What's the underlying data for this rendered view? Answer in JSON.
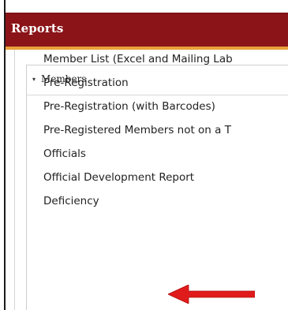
{
  "header": {
    "title": "Reports",
    "bar_color": "#8b1418",
    "underline_color": "#e9a13a"
  },
  "section": {
    "caret_icon": "caret-down-icon",
    "caret_glyph": "▾",
    "title": "Members",
    "expanded": true
  },
  "menu": {
    "items": [
      {
        "label": "Member List (Excel and Mailing Lab"
      },
      {
        "label": "Pre-Registration"
      },
      {
        "label": "Pre-Registration (with Barcodes)"
      },
      {
        "label": "Pre-Registered Members not on a T"
      },
      {
        "label": "Officials"
      },
      {
        "label": "Official Development Report"
      },
      {
        "label": "Deficiency"
      }
    ]
  },
  "annotation": {
    "icon": "red-arrow-icon",
    "color": "#e01b1b",
    "points_to": "Deficiency"
  }
}
